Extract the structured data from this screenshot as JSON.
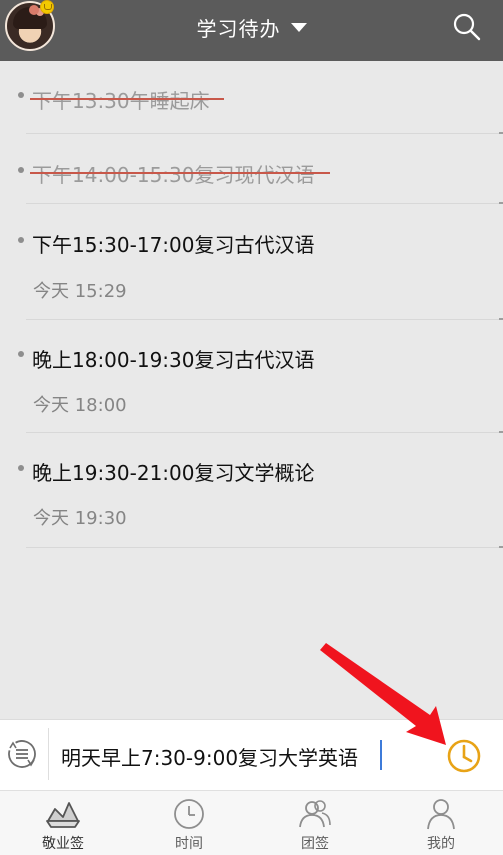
{
  "header": {
    "title": "学习待办",
    "avatar_icon": "user-avatar",
    "search_icon": "search-icon",
    "dropdown_icon": "caret-down-icon"
  },
  "todos": [
    {
      "text": "下午13:30午睡起床",
      "done": true,
      "time": ""
    },
    {
      "text": "下午14:00-15:30复习现代汉语",
      "done": true,
      "time": ""
    },
    {
      "text": "下午15:30-17:00复习古代汉语",
      "done": false,
      "time": "今天 15:29"
    },
    {
      "text": "晚上18:00-19:30复习古代汉语",
      "done": false,
      "time": "今天 18:00"
    },
    {
      "text": "晚上19:30-21:00复习文学概论",
      "done": false,
      "time": "今天 19:30"
    }
  ],
  "input": {
    "value": "明天早上7:30-9:00复习大学英语",
    "repeat_icon": "repeat-icon",
    "reminder_icon": "clock-icon"
  },
  "colors": {
    "header_bg": "#5b5b5b",
    "strike": "#c8584a",
    "accent_clock": "#e8a316",
    "arrow": "#f0141e"
  },
  "tabs": [
    {
      "label": "敬业签",
      "icon": "notes-icon",
      "active": true
    },
    {
      "label": "时间",
      "icon": "clock-icon",
      "active": false
    },
    {
      "label": "团签",
      "icon": "team-icon",
      "active": false
    },
    {
      "label": "我的",
      "icon": "profile-icon",
      "active": false
    }
  ]
}
